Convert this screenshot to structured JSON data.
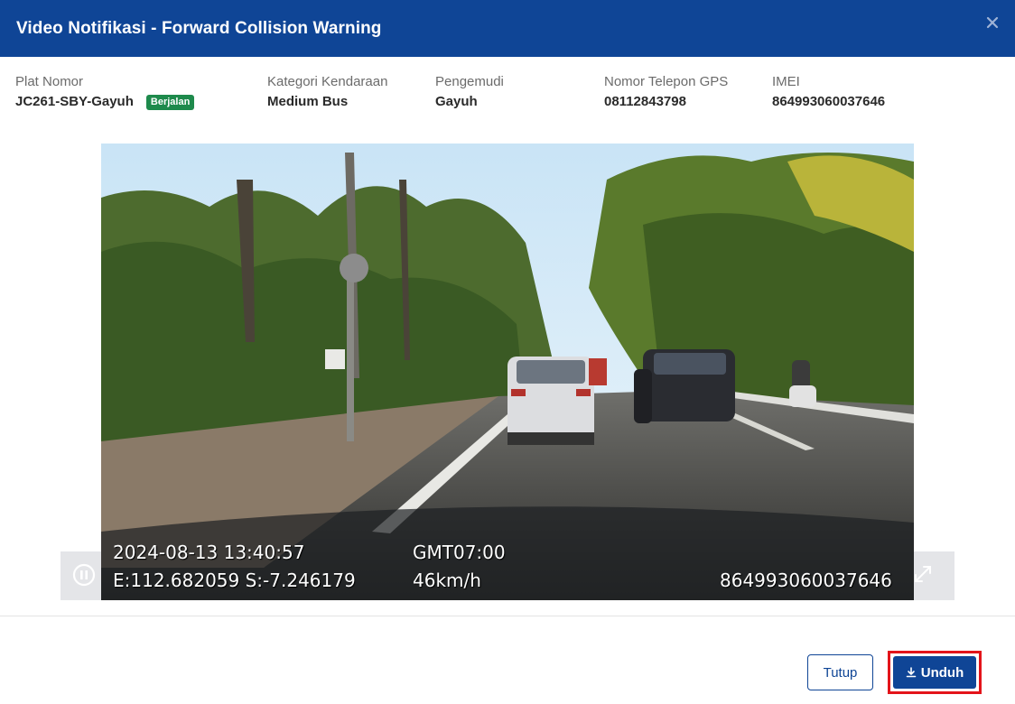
{
  "header": {
    "title": "Video Notifikasi - Forward Collision Warning"
  },
  "info": {
    "plate_label": "Plat Nomor",
    "plate_value": "JC261-SBY-Gayuh",
    "status_badge": "Berjalan",
    "category_label": "Kategori Kendaraan",
    "category_value": "Medium Bus",
    "driver_label": "Pengemudi",
    "driver_value": "Gayuh",
    "phone_label": "Nomor Telepon GPS",
    "phone_value": "08112843798",
    "imei_label": "IMEI",
    "imei_value": "864993060037646"
  },
  "video": {
    "datetime": "2024-08-13  13:40:57",
    "timezone": "GMT07:00",
    "coords": "E:112.682059  S:-7.246179",
    "speed": "46km/h",
    "device_id": "864993060037646"
  },
  "icons": {
    "close": "close-icon",
    "pause": "pause-icon",
    "expand": "expand-icon",
    "download": "download-icon"
  },
  "footer": {
    "close_label": "Tutup",
    "download_label": "Unduh"
  },
  "colors": {
    "primary": "#0f4596",
    "badge": "#1e8a4c",
    "highlight": "#e3141a"
  }
}
